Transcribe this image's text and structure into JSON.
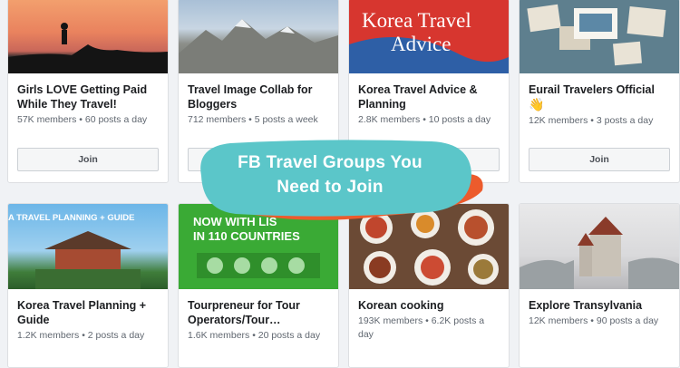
{
  "cards": [
    {
      "title": "Girls LOVE Getting Paid While They Travel!",
      "meta": "57K members • 60 posts a day",
      "join": "Join"
    },
    {
      "title": "Travel Image Collab for Bloggers",
      "meta": "712 members • 5 posts a week"
    },
    {
      "title": "Korea Travel Advice & Planning",
      "meta": "2.8K members • 10 posts a day",
      "image_text_line1": "Korea Travel",
      "image_text_line2": "Advice"
    },
    {
      "title": "Eurail Travelers Official",
      "emoji": "👋",
      "meta": "12K members • 3 posts a day",
      "join": "Join"
    },
    {
      "title": "Korea Travel Planning + Guide",
      "meta": "1.2K members • 2 posts a day",
      "image_text": "A TRAVEL PLANNING + GUIDE"
    },
    {
      "title": "Tourpreneur for Tour Operators/Tour…",
      "meta": "1.6K members • 20 posts a day",
      "image_text_line1": "NOW WITH LIS",
      "image_text_line2": "IN 110 COUNTRIES"
    },
    {
      "title": "Korean cooking",
      "meta": "193K members • 6.2K posts a day"
    },
    {
      "title": "Explore Transylvania",
      "meta": "12K members • 90 posts a day"
    }
  ],
  "overlay": {
    "line1": "FB Travel Groups You",
    "line2": "Need to Join"
  },
  "colors": {
    "overlay_teal": "#5bc6c9",
    "overlay_orange": "#ec5b2c"
  }
}
